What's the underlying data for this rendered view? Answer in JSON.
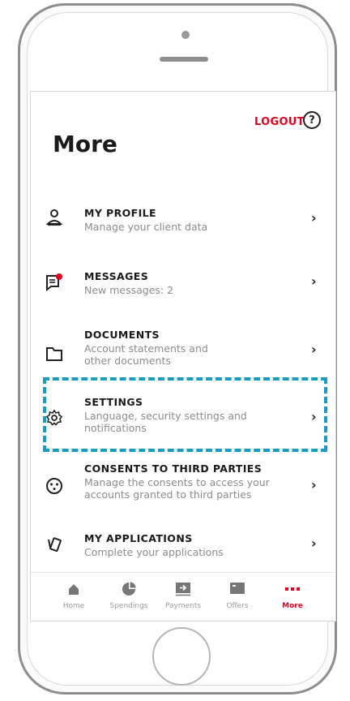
{
  "header": {
    "logout_label": "LOGOUT",
    "help_icon_glyph": "?"
  },
  "page": {
    "title": "More"
  },
  "menu": [
    {
      "label": "MY PROFILE",
      "sub": "Manage your client data",
      "icon": "person-icon"
    },
    {
      "label": "MESSAGES",
      "sub": "New messages: 2",
      "icon": "message-icon",
      "badge_color": "#e4001f"
    },
    {
      "label": "DOCUMENTS",
      "sub": "Account statements and other documents",
      "icon": "folder-icon"
    },
    {
      "label": "SETTINGS",
      "sub": "Language, security settings and notifications",
      "icon": "gear-icon"
    },
    {
      "label": "CONSENTS TO THIRD PARTIES",
      "sub": "Manage the consents to access your accounts granted to third parties",
      "icon": "plug-icon"
    },
    {
      "label": "MY APPLICATIONS",
      "sub": "Complete your applications",
      "icon": "cards-icon"
    }
  ],
  "chevron": "›",
  "tabs": [
    {
      "label": "Home",
      "icon": "home-icon"
    },
    {
      "label": "Spendings",
      "icon": "pie-chart-icon"
    },
    {
      "label": "Payments",
      "icon": "payments-icon"
    },
    {
      "label": "Offers",
      "icon": "offers-icon"
    },
    {
      "label": "More",
      "icon": "more-dots-icon",
      "active": true
    }
  ],
  "colors": {
    "accent_red": "#e4001f",
    "highlight_blue": "#1a9ac7"
  }
}
